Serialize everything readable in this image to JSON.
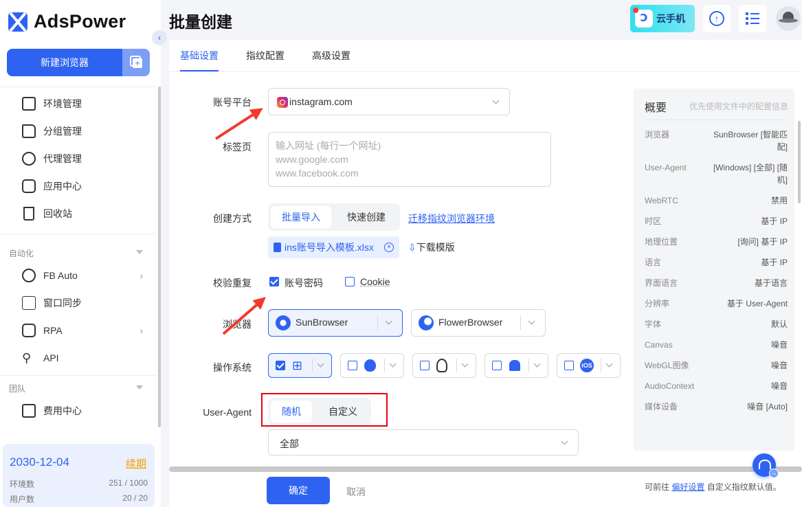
{
  "app": {
    "name": "AdsPower",
    "page_title": "批量创建"
  },
  "sidebar": {
    "new_browser": "新建浏览器",
    "items": [
      {
        "label": "环境管理",
        "icon": "browser-window-icon"
      },
      {
        "label": "分组管理",
        "icon": "folder-icon"
      },
      {
        "label": "代理管理",
        "icon": "globe-icon"
      },
      {
        "label": "应用中心",
        "icon": "puzzle-icon"
      },
      {
        "label": "回收站",
        "icon": "trash-icon"
      }
    ],
    "automation_title": "自动化",
    "automation_items": [
      {
        "label": "FB Auto",
        "icon": "sync-icon"
      },
      {
        "label": "窗口同步",
        "icon": "window-sync-icon"
      },
      {
        "label": "RPA",
        "icon": "robot-icon"
      },
      {
        "label": "API",
        "icon": "plug-icon"
      }
    ],
    "team_title": "团队",
    "team_items": [
      {
        "label": "费用中心",
        "icon": "wallet-icon"
      }
    ],
    "account": {
      "expire_date": "2030-12-04",
      "renew_label": "续期",
      "env_label": "环境数",
      "env_value": "251 / 1000",
      "user_label": "用户数",
      "user_value": "20 / 20"
    }
  },
  "header": {
    "cloud_phone": "云手机"
  },
  "tabs": [
    "基础设置",
    "指纹配置",
    "高级设置"
  ],
  "form": {
    "platform_label": "账号平台",
    "platform_value": "instagram.com",
    "tabs_label": "标签页",
    "tabs_placeholder": [
      "输入网址 (每行一个网址)",
      "www.google.com",
      "www.facebook.com"
    ],
    "create_label": "创建方式",
    "create_options": [
      "批量导入",
      "快速创建"
    ],
    "migrate_link": "迁移指纹浏览器环境",
    "file_name": "ins账号导入模板.xlsx",
    "download_template": "下载模版",
    "dedupe_label": "校验重复",
    "dedupe_account": "账号密码",
    "dedupe_cookie": "Cookie",
    "browser_label": "浏览器",
    "browsers": [
      "SunBrowser",
      "FlowerBrowser"
    ],
    "os_label": "操作系统",
    "os_options": [
      "windows-icon",
      "apple-icon",
      "linux-icon",
      "android-icon",
      "ios-icon"
    ],
    "ua_label": "User-Agent",
    "ua_options": [
      "随机",
      "自定义"
    ],
    "ua_select_value": "全部",
    "confirm": "确定",
    "cancel": "取消"
  },
  "summary": {
    "title": "概要",
    "hint": "优先使用文件中的配置信息",
    "rows": [
      {
        "k": "浏览器",
        "v": "SunBrowser [智能匹配]"
      },
      {
        "k": "User-Agent",
        "v": "[Windows] [全部] [随机]"
      },
      {
        "k": "WebRTC",
        "v": "禁用"
      },
      {
        "k": "时区",
        "v": "基于 IP"
      },
      {
        "k": "地理位置",
        "v": "[询问] 基于 IP"
      },
      {
        "k": "语言",
        "v": "基于 IP"
      },
      {
        "k": "界面语言",
        "v": "基于语言"
      },
      {
        "k": "分辨率",
        "v": "基于 User-Agent"
      },
      {
        "k": "字体",
        "v": "默认"
      },
      {
        "k": "Canvas",
        "v": "噪音"
      },
      {
        "k": "WebGL图像",
        "v": "噪音"
      },
      {
        "k": "AudioContext",
        "v": "噪音"
      },
      {
        "k": "媒体设备",
        "v": "噪音 [Auto]"
      }
    ],
    "foot_prefix": "可前往",
    "foot_link": "偏好设置",
    "foot_suffix": "自定义指纹默认值。"
  },
  "colors": {
    "primary": "#2e63f2",
    "annotation_red": "#f23a2a",
    "renew_orange": "#f3a000"
  }
}
